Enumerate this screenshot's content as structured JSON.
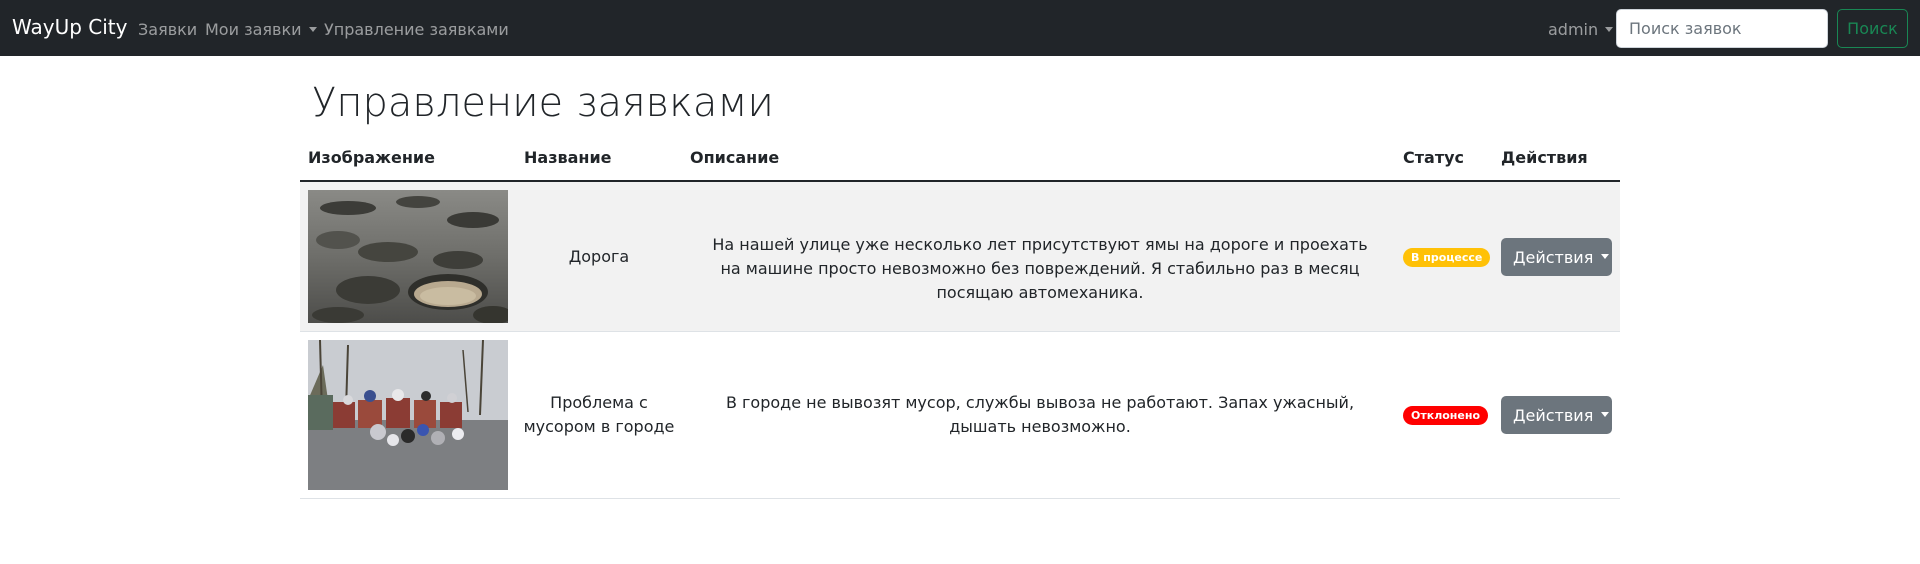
{
  "navbar": {
    "brand": "WayUp City",
    "links": [
      {
        "label": "Заявки"
      },
      {
        "label": "Мои заявки"
      },
      {
        "label": "Управление заявками"
      }
    ],
    "user": "admin",
    "search_placeholder": "Поиск заявок",
    "search_button": "Поиск"
  },
  "main": {
    "title": "Управление заявками",
    "columns": [
      "Изображение",
      "Название",
      "Описание",
      "Статус",
      "Действия"
    ],
    "rows": [
      {
        "image": "pothole-road-photo",
        "name": "Дорога",
        "description": "На нашей улице уже несколько лет присутствуют ямы на дороге и проехать на машине просто невозможно без повреждений. Я стабильно раз в месяц посящаю автомеханика.",
        "status": "В процессе",
        "status_color": "#ffc107",
        "action": "Действия"
      },
      {
        "image": "garbage-bins-photo",
        "name": "Проблема с мусором в городе",
        "description": "В городе не вывозят мусор, службы вывоза не работают. Запах ужасный, дышать невозможно.",
        "status": "Отклонено",
        "status_color": "#ff0000",
        "action": "Действия"
      }
    ]
  }
}
